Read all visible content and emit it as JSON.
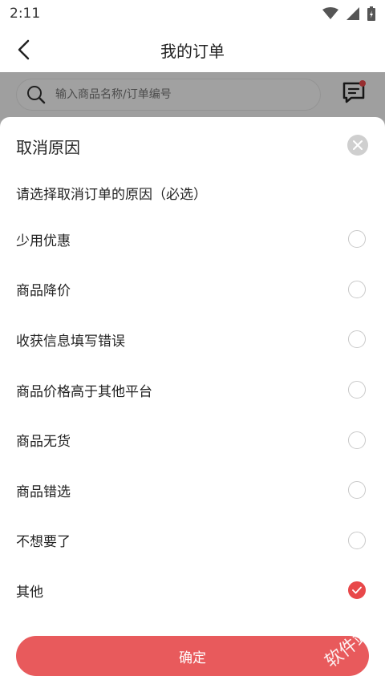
{
  "status_bar": {
    "time": "2:11"
  },
  "header": {
    "title": "我的订单"
  },
  "search": {
    "placeholder": "输入商品名称/订单编号"
  },
  "sheet": {
    "title": "取消原因",
    "subtitle": "请选择取消订单的原因（必选）",
    "reasons": [
      {
        "label": "少用优惠",
        "selected": false
      },
      {
        "label": "商品降价",
        "selected": false
      },
      {
        "label": "收获信息填写错误",
        "selected": false
      },
      {
        "label": "商品价格高于其他平台",
        "selected": false
      },
      {
        "label": "商品无货",
        "selected": false
      },
      {
        "label": "商品错选",
        "selected": false
      },
      {
        "label": "不想要了",
        "selected": false
      },
      {
        "label": "其他",
        "selected": true
      }
    ],
    "confirm_label": "确定"
  },
  "watermark": "软件站",
  "colors": {
    "accent": "#e8484a",
    "button": "#e85a5c"
  }
}
